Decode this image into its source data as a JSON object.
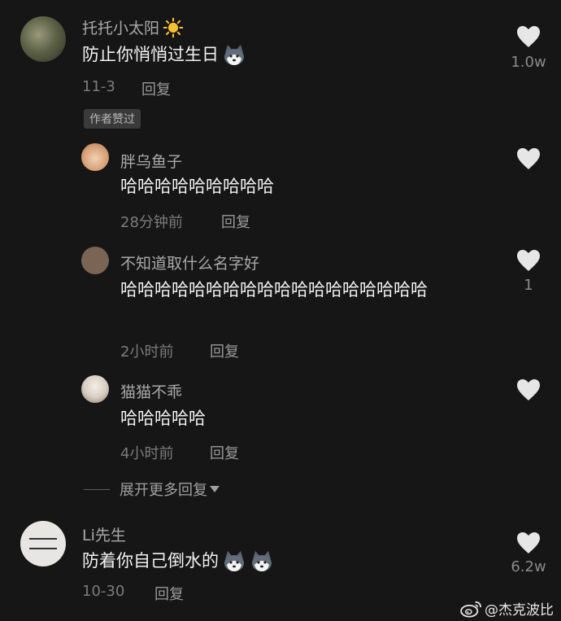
{
  "comments": [
    {
      "username": "托托小太阳",
      "text": "防止你悄悄过生日",
      "date": "11-3",
      "reply_label": "回复",
      "like_count": "1.0w",
      "badge": "作者赞过",
      "icons": [
        "sun-icon",
        "husky-emoji-icon"
      ]
    },
    {
      "username": "Li先生",
      "text": "防着你自己倒水的",
      "date": "10-30",
      "reply_label": "回复",
      "like_count": "6.2w",
      "icons": [
        "husky-emoji-icon",
        "husky-emoji-icon"
      ]
    }
  ],
  "replies": [
    {
      "username": "胖乌鱼子",
      "text": "哈哈哈哈哈哈哈哈哈",
      "time": "28分钟前",
      "reply_label": "回复",
      "like_count": ""
    },
    {
      "username": "不知道取什么名字好",
      "text": "哈哈哈哈哈哈哈哈哈哈哈哈哈哈哈哈哈哈",
      "time": "2小时前",
      "reply_label": "回复",
      "like_count": "1"
    },
    {
      "username": "猫猫不乖",
      "text": "哈哈哈哈哈",
      "time": "4小时前",
      "reply_label": "回复",
      "like_count": ""
    }
  ],
  "expand_more": "展开更多回复",
  "watermark": "@杰克波比",
  "colors": {
    "background": "#161616",
    "heart": "#e6e6e6",
    "badge_bg": "#3a3a3a"
  }
}
